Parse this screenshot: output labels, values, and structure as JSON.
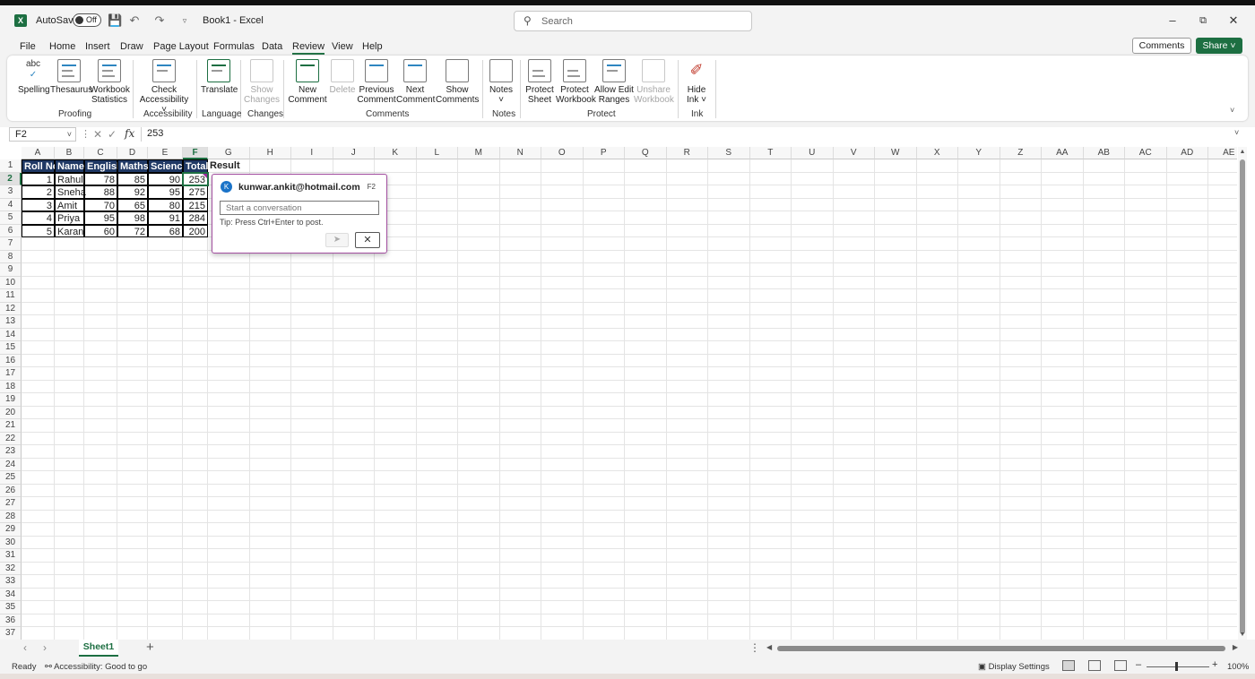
{
  "titlebar": {
    "autosave_label": "AutoSave",
    "autosave_state": "Off",
    "doc_title": "Book1  -  Excel",
    "search_placeholder": "Search"
  },
  "menu": {
    "items": [
      "File",
      "Home",
      "Insert",
      "Draw",
      "Page Layout",
      "Formulas",
      "Data",
      "Review",
      "View",
      "Help"
    ],
    "active": "Review",
    "comments_label": "Comments",
    "share_label": "Share"
  },
  "ribbon": {
    "buttons": [
      {
        "line1": "Spelling",
        "line2": "",
        "disabled": false
      },
      {
        "line1": "Thesaurus",
        "line2": "",
        "disabled": false
      },
      {
        "line1": "Workbook",
        "line2": "Statistics",
        "disabled": false
      },
      {
        "line1": "Check",
        "line2": "Accessibility ˅",
        "disabled": false
      },
      {
        "line1": "Translate",
        "line2": "",
        "disabled": false
      },
      {
        "line1": "Show",
        "line2": "Changes",
        "disabled": true
      },
      {
        "line1": "New",
        "line2": "Comment",
        "disabled": false
      },
      {
        "line1": "Delete",
        "line2": "",
        "disabled": true
      },
      {
        "line1": "Previous",
        "line2": "Comment",
        "disabled": false
      },
      {
        "line1": "Next",
        "line2": "Comment",
        "disabled": false
      },
      {
        "line1": "Show",
        "line2": "Comments",
        "disabled": false
      },
      {
        "line1": "Notes",
        "line2": "˅",
        "disabled": false
      },
      {
        "line1": "Protect",
        "line2": "Sheet",
        "disabled": false
      },
      {
        "line1": "Protect",
        "line2": "Workbook",
        "disabled": false
      },
      {
        "line1": "Allow Edit",
        "line2": "Ranges",
        "disabled": false
      },
      {
        "line1": "Unshare",
        "line2": "Workbook",
        "disabled": true
      },
      {
        "line1": "Hide",
        "line2": "Ink ˅",
        "disabled": false
      }
    ],
    "groups": [
      "Proofing",
      "Accessibility",
      "Language",
      "Changes",
      "Comments",
      "Notes",
      "Protect",
      "Ink"
    ]
  },
  "formula_bar": {
    "name_box": "F2",
    "fx": "fx",
    "value": "253"
  },
  "columns": [
    "A",
    "B",
    "C",
    "D",
    "E",
    "F",
    "G",
    "H",
    "I",
    "J",
    "K",
    "L",
    "M",
    "N",
    "O",
    "P",
    "Q",
    "R",
    "S",
    "T",
    "U",
    "V",
    "W",
    "X",
    "Y",
    "Z",
    "AA",
    "AB",
    "AC",
    "AD",
    "AE"
  ],
  "rows": [
    "1",
    "2",
    "3",
    "4",
    "5",
    "6",
    "7",
    "8",
    "9",
    "10",
    "11",
    "12",
    "13",
    "14",
    "15",
    "16",
    "17",
    "18",
    "19",
    "20",
    "21",
    "22",
    "23",
    "24",
    "25",
    "26",
    "27",
    "28",
    "29",
    "30",
    "31",
    "32",
    "33",
    "34",
    "35",
    "36",
    "37"
  ],
  "sheet": {
    "headers": [
      "Roll No",
      "Name",
      "English",
      "Maths",
      "Science",
      "Total"
    ],
    "result_header": "Result",
    "data": [
      [
        "1",
        "Rahul",
        "78",
        "85",
        "90",
        "253"
      ],
      [
        "2",
        "Sneha",
        "88",
        "92",
        "95",
        "275"
      ],
      [
        "3",
        "Amit",
        "70",
        "65",
        "80",
        "215"
      ],
      [
        "4",
        "Priya",
        "95",
        "98",
        "91",
        "284"
      ],
      [
        "5",
        "Karan",
        "60",
        "72",
        "68",
        "200"
      ]
    ]
  },
  "comment": {
    "avatar_letter": "K",
    "user": "kunwar.ankit@hotmail.com",
    "cell_ref": "F2",
    "placeholder": "Start a conversation",
    "tip": "Tip: Press Ctrl+Enter to post."
  },
  "tabs": {
    "sheet_name": "Sheet1",
    "add": "+"
  },
  "status": {
    "ready": "Ready",
    "accessibility": "Accessibility: Good to go",
    "display_settings": "Display Settings",
    "zoom": "100%"
  },
  "colors": {
    "accent": "#1d6f42",
    "header_fill": "#1f3864",
    "comment_border": "#a34fa0"
  }
}
